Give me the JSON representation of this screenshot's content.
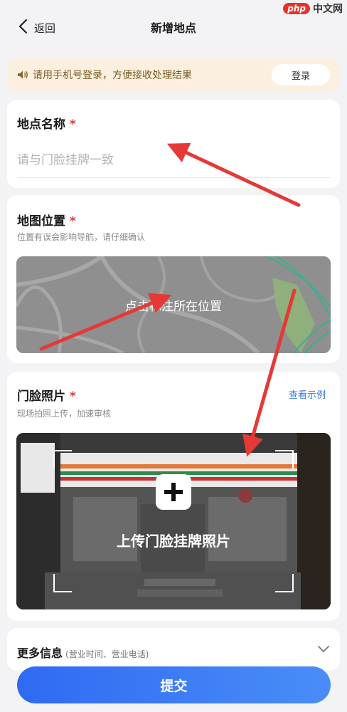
{
  "nav": {
    "back_label": "返回",
    "title": "新增地点"
  },
  "watermark": {
    "logo": "php",
    "text": "中文网"
  },
  "banner": {
    "text": "请用手机号登录，方便接收处理结果",
    "login_label": "登录"
  },
  "name_section": {
    "label": "地点名称",
    "required_mark": "*",
    "placeholder": "请与门脸挂牌一致"
  },
  "map_section": {
    "label": "地图位置",
    "required_mark": "*",
    "hint": "位置有误会影响导航，请仔细确认",
    "map_prompt": "点击标注所在位置"
  },
  "photo_section": {
    "label": "门脸照片",
    "required_mark": "*",
    "hint": "现场拍照上传，加速审核",
    "example_link": "查看示例",
    "upload_prompt": "上传门脸挂牌照片"
  },
  "more_section": {
    "label": "更多信息",
    "hint": "(营业时间、营业电话)"
  },
  "submit_label": "提交",
  "colors": {
    "accent": "#2f6af3",
    "required": "#e03a3a",
    "banner_bg": "#fbf0df",
    "annotation_arrow": "#e53935"
  }
}
